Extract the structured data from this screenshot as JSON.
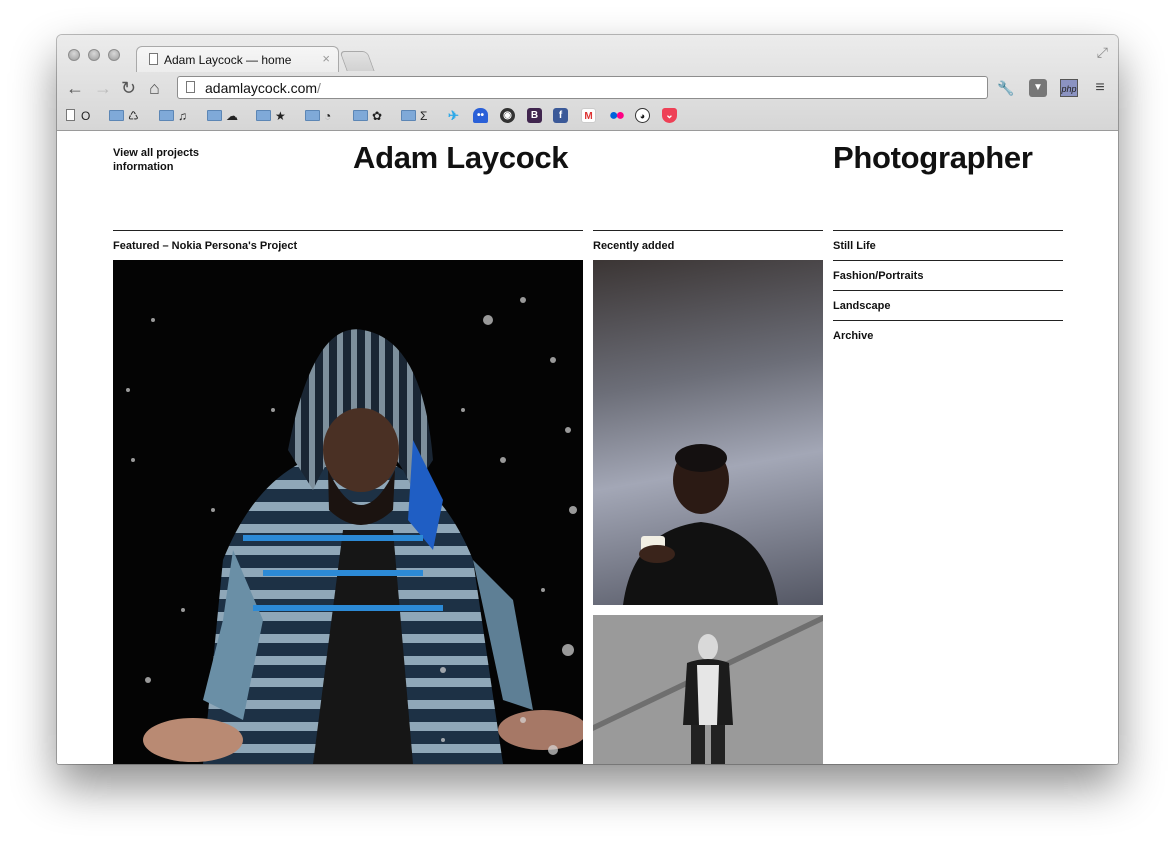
{
  "browser": {
    "tab_title": "Adam Laycock — home",
    "tab_close": "×",
    "url_host": "adamlaycock.com",
    "url_path": "/",
    "bookmarks": [
      {
        "label": "O",
        "type": "page"
      },
      {
        "label": "♺",
        "type": "folder"
      },
      {
        "label": "♫",
        "type": "folder"
      },
      {
        "label": "☁",
        "type": "folder"
      },
      {
        "label": "★",
        "type": "folder"
      },
      {
        "label": "◔",
        "type": "folder"
      },
      {
        "label": "✿",
        "type": "folder"
      },
      {
        "label": "Σ",
        "type": "folder"
      }
    ],
    "bookmark_icons": [
      "twitter-icon",
      "pacman-icon",
      "github-icon",
      "bootstrap-icon",
      "facebook-icon",
      "gmail-icon",
      "flickr-icon",
      "panda-icon",
      "pocket-icon"
    ],
    "bootstrap_glyph": "B",
    "facebook_glyph": "f",
    "gmail_glyph": "M",
    "php_label": "php"
  },
  "site": {
    "nav": [
      "View all projects",
      "information"
    ],
    "title": "Adam Laycock",
    "subtitle": "Photographer",
    "featured_label": "Featured – Nokia Persona's Project",
    "recent_label": "Recently added",
    "categories": [
      "Still Life",
      "Fashion/Portraits",
      "Landscape",
      "Archive"
    ]
  }
}
